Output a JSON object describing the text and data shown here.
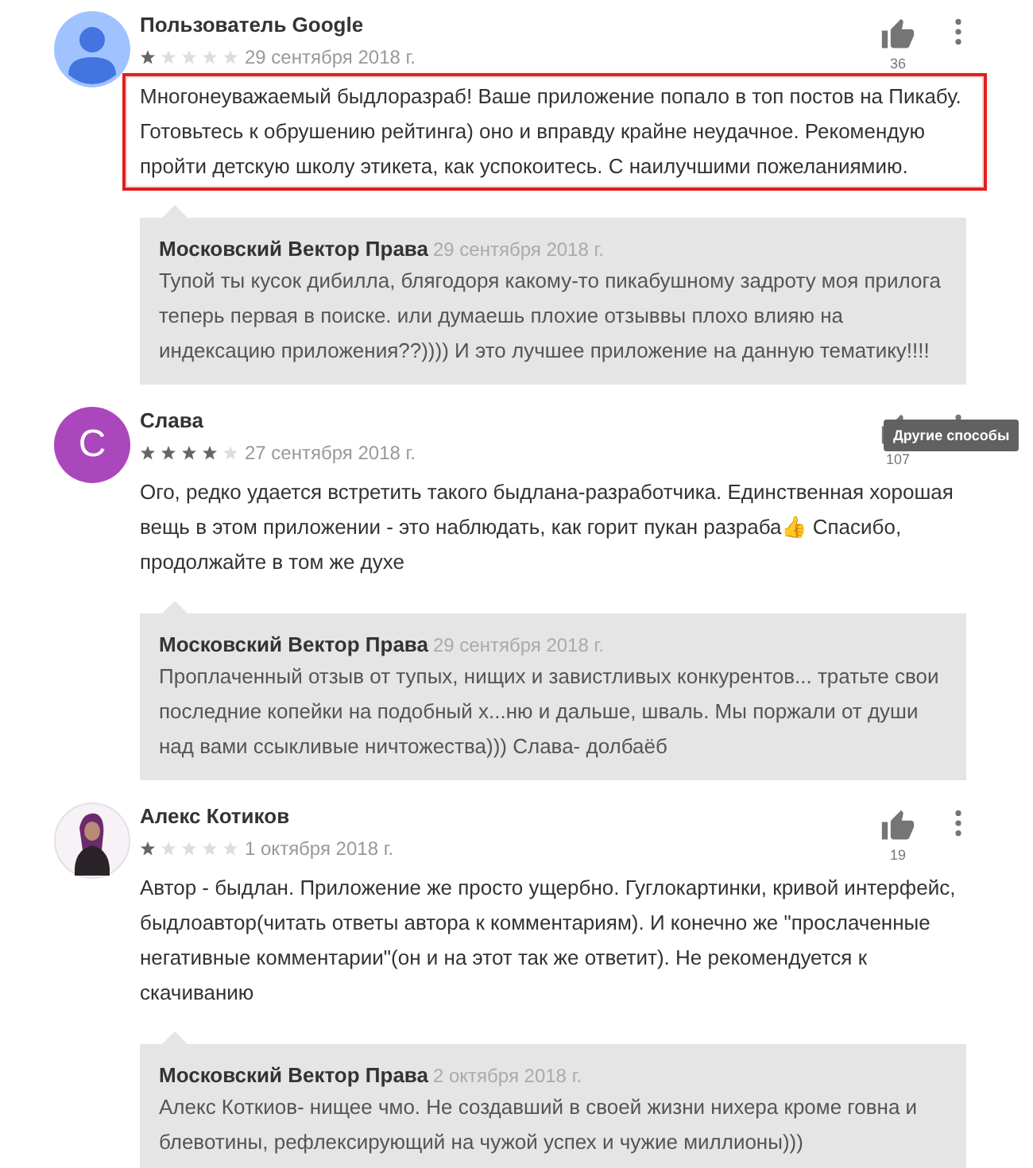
{
  "reviews": [
    {
      "avatar": {
        "kind": "silhouette"
      },
      "author": "Пользователь Google",
      "stars": 1,
      "date": "29 сентября 2018 г.",
      "likes": "36",
      "highlighted": true,
      "text": "Многонеуважаемый быдлоразраб! Ваше приложение попало в топ постов на Пикабу. Готовьтесь к обрушению рейтинга) оно и вправду крайне неудачное. Рекомендую пройти детскую школу этикета, как успокоитесь. С наилучшими пожеланиямию.",
      "reply": {
        "author": "Московский Вектор Права",
        "date": "29 сентября 2018 г.",
        "text": "Тупой ты кусок дибилла, блягодоря какому-то пикабушному задроту моя прилога теперь первая в поиске. или думаешь плохие отзыввы плохо влияю на индексацию приложения??)))) И это лучшее приложение на данную тематику!!!!"
      }
    },
    {
      "avatar": {
        "kind": "letter",
        "letter": "C",
        "color": "#ab47bc"
      },
      "author": "Слава",
      "stars": 4,
      "date": "27 сентября 2018 г.",
      "likes": "107",
      "tooltip": "Другие способы",
      "highlighted": false,
      "text": "Ого, редко удается встретить такого быдлана-разработчика. Единственная хорошая вещь в этом приложении - это наблюдать, как горит пукан разраба👍 Спасибо, продолжайте в том же духе",
      "reply": {
        "author": "Московский Вектор Права",
        "date": "29 сентября 2018 г.",
        "text": "Проплаченный отзыв от тупых, нищих и завистливых конкурентов... тратьте свои последние копейки на подобный х...ню и дальше, шваль. Мы поржали от души над вами ссыкливые ничтожества))) Слава- долбаёб"
      }
    },
    {
      "author": "Алекс Котиков",
      "stars": 1,
      "date": "1 октября 2018 г.",
      "likes": "19",
      "highlighted": false,
      "text": "Автор - быдлан. Приложение же просто ущербно. Гуглокартинки, кривой интерфейс, быдлоавтор(читать ответы автора к комментариям). И конечно же \"прослаченные негативные комментарии\"(он и на этот так же ответит). Не рекомендуется к скачиванию",
      "reply": {
        "author": "Московский Вектор Права",
        "date": "2 октября 2018 г.",
        "text": "Алекс Коткиов- нищее чмо. Не создавший в своей жизни нихера кроме говна и блевотины, рефлексирующий на чужой успех и чужие миллионы)))"
      }
    }
  ]
}
